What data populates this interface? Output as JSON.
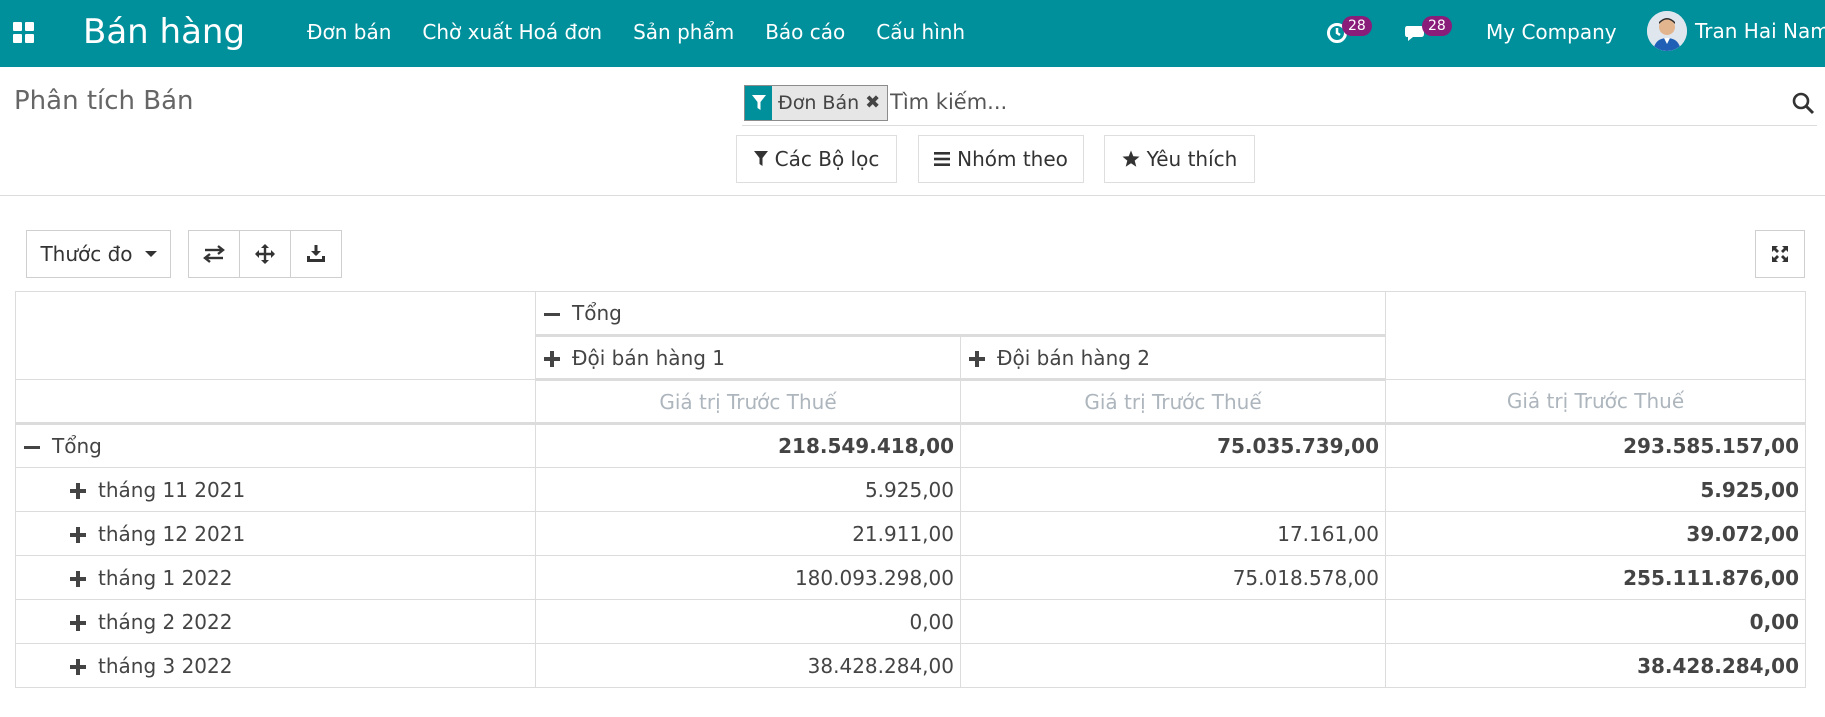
{
  "navbar": {
    "brand": "Bán hàng",
    "menu": [
      "Đơn bán",
      "Chờ xuất Hoá đơn",
      "Sản phẩm",
      "Báo cáo",
      "Cấu hình"
    ],
    "activity_count": "28",
    "message_count": "28",
    "company": "My Company",
    "user": "Tran Hai Nam",
    "color": "#00909c",
    "badge_color": "#8a1c7a"
  },
  "control_panel": {
    "title": "Phân tích Bán",
    "facet_label": "Đơn Bán",
    "search_placeholder": "Tìm kiếm...",
    "filters_label": "Các Bộ lọc",
    "groupby_label": "Nhóm theo",
    "favorites_label": "Yêu thích"
  },
  "pivot_toolbar": {
    "measures_label": "Thước đo",
    "tools": [
      "flip-axis-icon",
      "expand-all-icon",
      "download-icon"
    ],
    "fullscreen": "expand-icon"
  },
  "pivot": {
    "col_total_label": "Tổng",
    "col_groups": [
      "Đội bán hàng 1",
      "Đội bán hàng 2"
    ],
    "measure_label": "Giá trị Trước Thuế",
    "row_total_label": "Tổng",
    "total_row": [
      "218.549.418,00",
      "75.035.739,00",
      "293.585.157,00"
    ],
    "rows": [
      {
        "label": "tháng 11 2021",
        "team1": "5.925,00",
        "team2": "",
        "total": "5.925,00"
      },
      {
        "label": "tháng 12 2021",
        "team1": "21.911,00",
        "team2": "17.161,00",
        "total": "39.072,00"
      },
      {
        "label": "tháng 1 2022",
        "team1": "180.093.298,00",
        "team2": "75.018.578,00",
        "total": "255.111.876,00"
      },
      {
        "label": "tháng 2 2022",
        "team1": "0,00",
        "team2": "",
        "total": "0,00"
      },
      {
        "label": "tháng 3 2022",
        "team1": "38.428.284,00",
        "team2": "",
        "total": "38.428.284,00"
      }
    ]
  }
}
